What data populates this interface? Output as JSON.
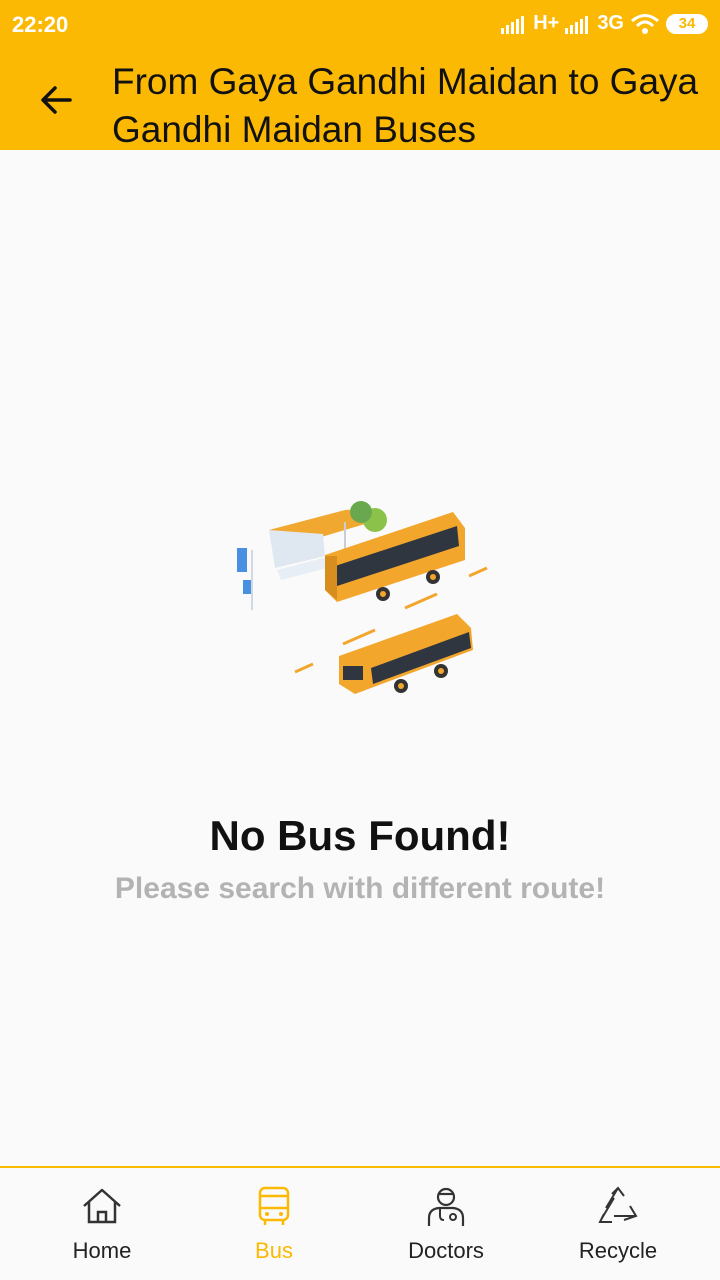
{
  "status_bar": {
    "time": "22:20",
    "network_1": "H+",
    "network_2": "3G",
    "battery": "34"
  },
  "toolbar": {
    "title": "From Gaya Gandhi Maidan to Gaya Gandhi Maidan Buses",
    "back_icon": "arrow-left-icon"
  },
  "empty_state": {
    "illustration": "bus-illustration",
    "title": "No Bus Found!",
    "subtitle": "Please search with different route!"
  },
  "bottom_nav": {
    "items": [
      {
        "label": "Home",
        "icon": "home-icon"
      },
      {
        "label": "Bus",
        "icon": "bus-icon",
        "active": true
      },
      {
        "label": "Doctors",
        "icon": "doctor-icon"
      },
      {
        "label": "Recycle",
        "icon": "recycle-icon"
      }
    ]
  },
  "colors": {
    "accent": "#fbb904",
    "background": "#fafafa",
    "subtitle": "#b3b3b3"
  }
}
